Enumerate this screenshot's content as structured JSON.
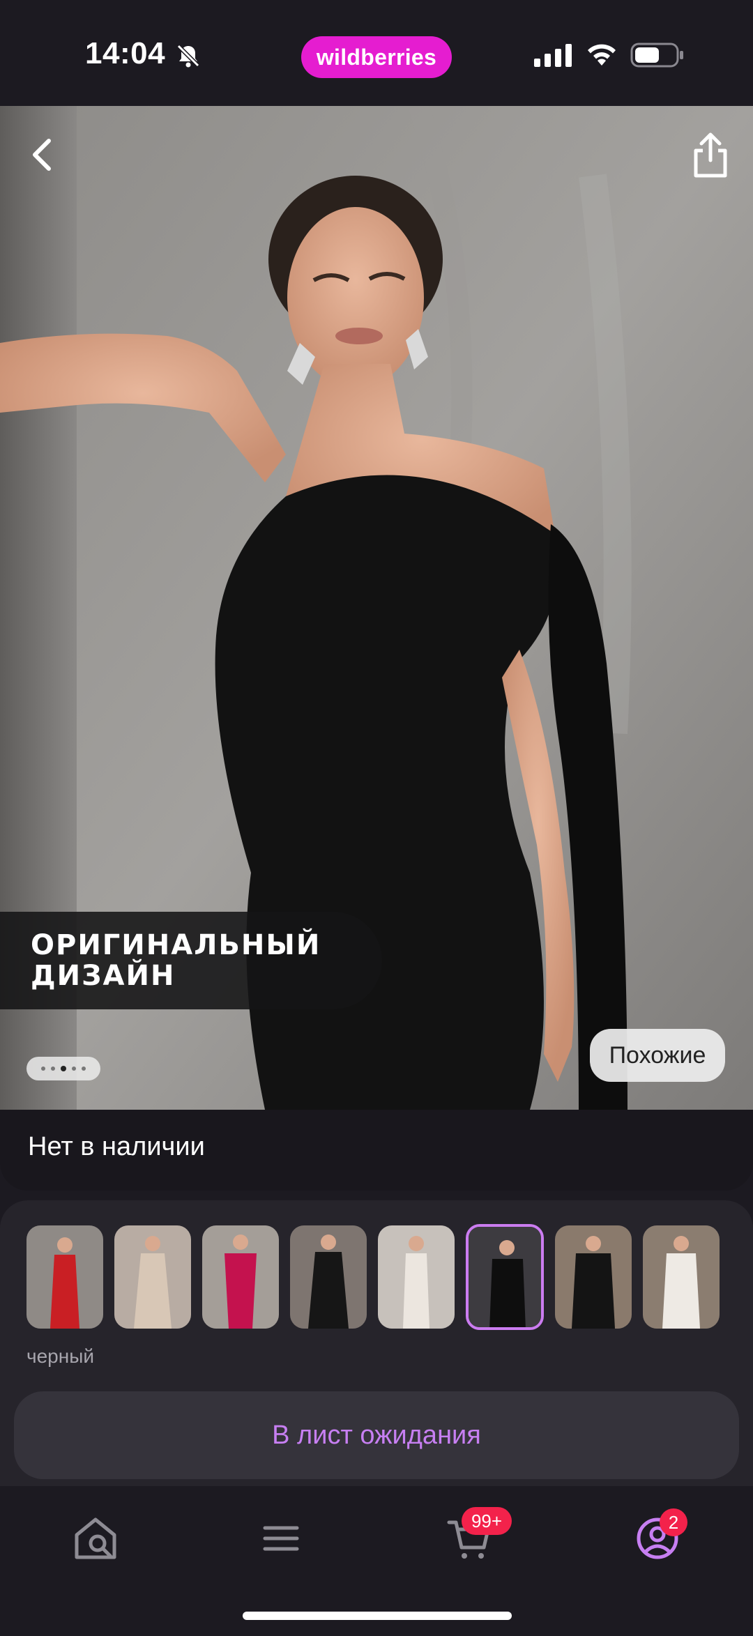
{
  "status_bar": {
    "time": "14:04",
    "brand": "wildberries",
    "icons": [
      "bell-off-icon",
      "signal-icon",
      "wifi-icon",
      "battery-icon"
    ]
  },
  "hero": {
    "promo_line1": "ОРИГИНАЛЬНЫЙ",
    "promo_line2": "ДИЗАЙН",
    "similar_button": "Похожие",
    "carousel_total": 5,
    "carousel_active": 3
  },
  "availability": "Нет в наличии",
  "variants": {
    "selected_index": 5,
    "color_label": "черный"
  },
  "actions": {
    "wait_list": "В лист ожидания"
  },
  "tab_bar": {
    "cart_badge": "99+",
    "profile_badge": "2"
  },
  "colors": {
    "brand": "#e51dd0",
    "accent": "#c77ff2",
    "badge": "#f3224b",
    "background": "#1c1a21"
  }
}
